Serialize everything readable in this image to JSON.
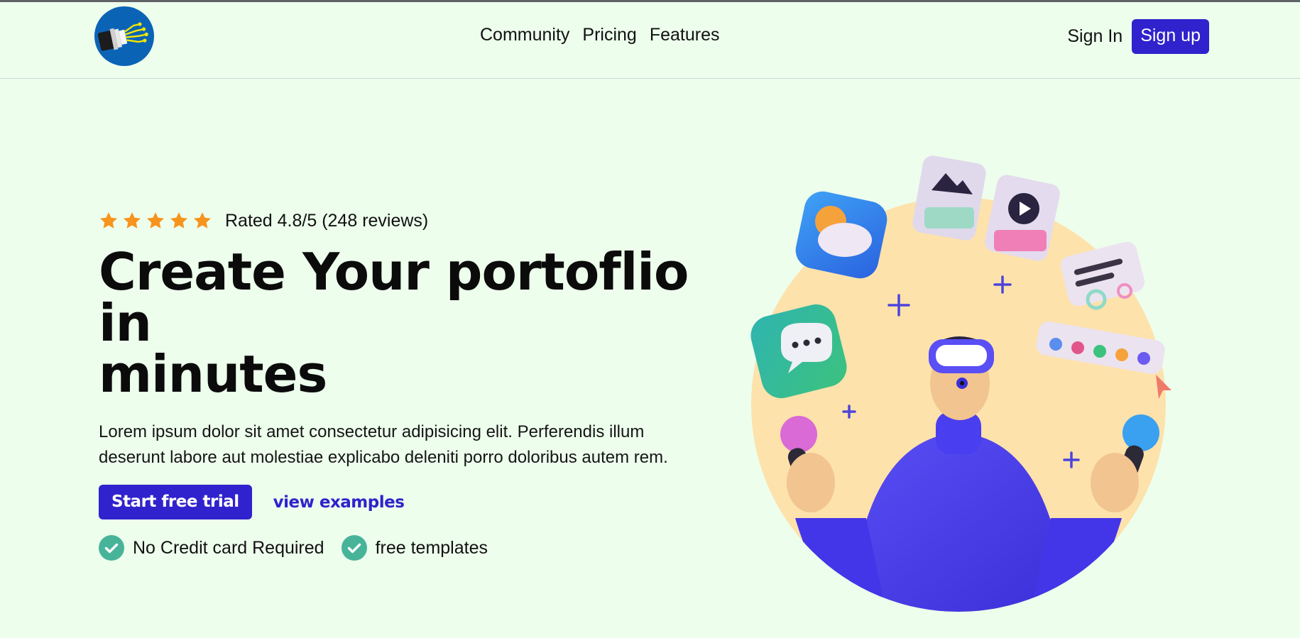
{
  "nav": {
    "logo_icon": "fiber-optic-cable-logo",
    "links": [
      "Community",
      "Pricing",
      "Features"
    ],
    "signin_label": "Sign In",
    "signup_label": "Sign up"
  },
  "hero": {
    "star_count": 5,
    "rating_text": "Rated 4.8/5 (248 reviews)",
    "title_line1": "Create Your portoflio in",
    "title_line2": "minutes",
    "description": "Lorem ipsum dolor sit amet consectetur adipisicing elit. Perferendis illum deserunt labore aut molestiae explicabo deleniti porro doloribus autem rem.",
    "cta_primary": "Start free trial",
    "cta_secondary": "view examples",
    "features": [
      "No Credit card Required",
      "free templates"
    ]
  },
  "colors": {
    "background": "#edfeec",
    "primary": "#3022cc",
    "star": "#f7941d",
    "check": "#47b49a",
    "illustration_circle": "#fde2ab"
  }
}
